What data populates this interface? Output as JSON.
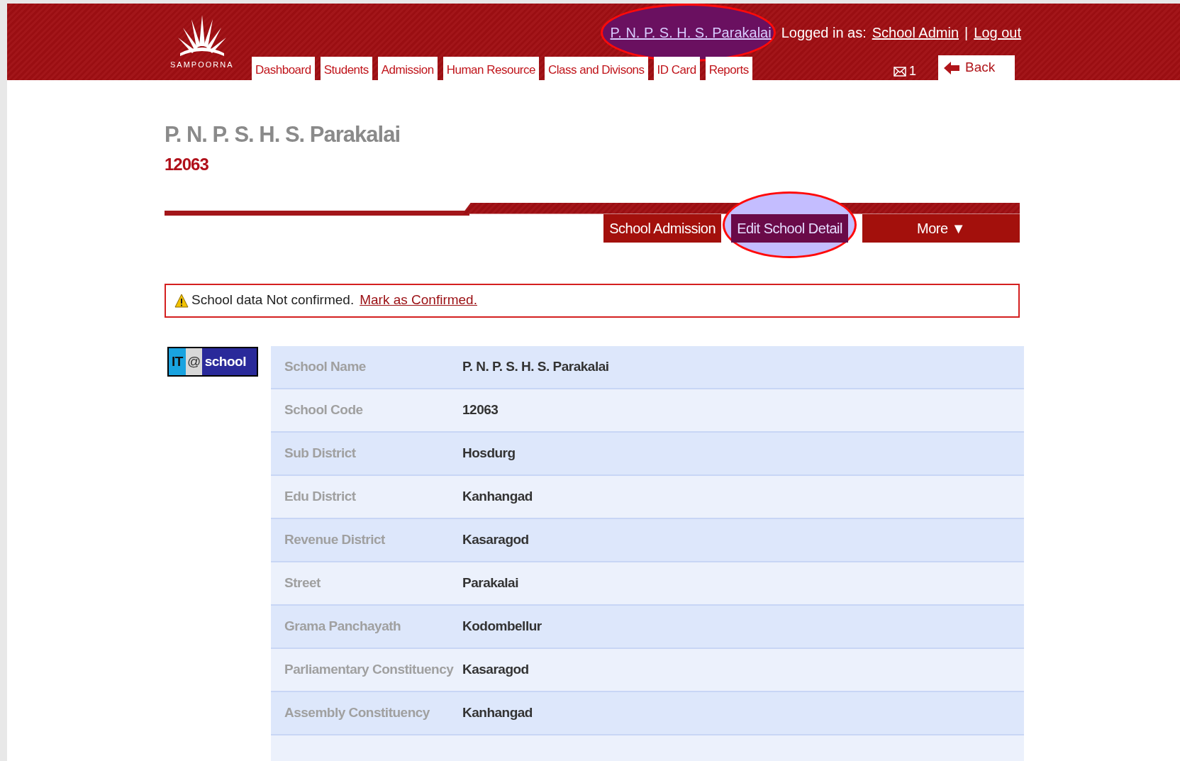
{
  "header": {
    "logo_text": "SAMPOORNA",
    "user_links": [
      {
        "kind": "link",
        "text": "P. N. P. S. H. S. Parakalai",
        "highlighted": true
      },
      {
        "kind": "text",
        "text": "Logged in as:",
        "highlighted": false
      },
      {
        "kind": "link",
        "text": "School Admin",
        "highlighted": false
      },
      {
        "kind": "separator",
        "text": "|",
        "highlighted": false
      },
      {
        "kind": "link",
        "text": "Log out",
        "highlighted": false
      }
    ],
    "nav": [
      "Dashboard",
      "Students",
      "Admission",
      "Human Resource",
      "Class and Divisons",
      "ID Card",
      "Reports"
    ],
    "messages": {
      "count": "1"
    },
    "back_button": "Back"
  },
  "page": {
    "title": "P. N. P. S. H. S. Parakalai",
    "code": "12063"
  },
  "actions": [
    {
      "label": "School Admission",
      "selected": false,
      "highlighted": false
    },
    {
      "label": "Edit School Detail",
      "selected": true,
      "highlighted": true
    },
    {
      "label": "More ▼",
      "selected": false,
      "highlighted": false
    }
  ],
  "alert": {
    "text": "School data Not confirmed.",
    "link": "Mark as Confirmed."
  },
  "badge": {
    "left": "IT",
    "at": "@",
    "right": "school"
  },
  "details": [
    {
      "label": "School Name",
      "value": "P. N. P. S. H. S. Parakalai"
    },
    {
      "label": "School Code",
      "value": "12063"
    },
    {
      "label": "Sub District",
      "value": "Hosdurg"
    },
    {
      "label": "Edu District",
      "value": "Kanhangad"
    },
    {
      "label": "Revenue District",
      "value": "Kasaragod"
    },
    {
      "label": "Street",
      "value": "Parakalai"
    },
    {
      "label": "Grama Panchayath",
      "value": "Kodombellur"
    },
    {
      "label": "Parliamentary Constituency",
      "value": "Kasaragod"
    },
    {
      "label": "Assembly Constituency",
      "value": "Kanhangad"
    }
  ]
}
